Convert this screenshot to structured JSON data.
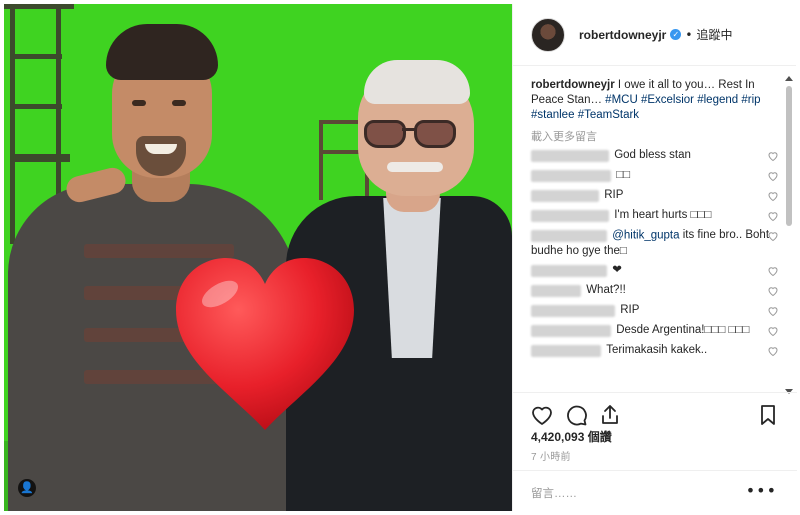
{
  "post": {
    "username": "robertdowneyjr",
    "verified_icon": "verified-check-icon",
    "header_dot": "•",
    "follow_status": "追蹤中",
    "caption": {
      "username": "robertdowneyjr",
      "text": "I owe it all to you… Rest In Peace Stan…",
      "hashtags": [
        "#MCU",
        "#Excelsior",
        "#legend",
        "#rip",
        "#stanlee",
        "#TeamStark"
      ]
    },
    "load_more": "載入更多留言",
    "comments": [
      {
        "text": "God bless stan",
        "mention": ""
      },
      {
        "text": "□□",
        "mention": ""
      },
      {
        "text": "RIP",
        "mention": ""
      },
      {
        "text": "I'm heart hurts □□□",
        "mention": ""
      },
      {
        "text": "its fine bro.. Boht budhe ho gye the□",
        "mention": "@hitik_gupta"
      },
      {
        "text": "❤",
        "mention": ""
      },
      {
        "text": "What?!!",
        "mention": ""
      },
      {
        "text": "RIP",
        "mention": ""
      },
      {
        "text": "Desde Argentina!□□□ □□□",
        "mention": ""
      },
      {
        "text": "Terimakasih kakek..",
        "mention": ""
      }
    ],
    "likes": "4,420,093 個讚",
    "time_ago": "7 小時前",
    "comment_placeholder": "留言……",
    "more_options": "•••",
    "photo_user_tag": "👤"
  },
  "colors": {
    "green_screen": "#3fd321",
    "link_blue": "#003569",
    "verified_blue": "#3897f0",
    "heart_red": "#e8202a"
  }
}
